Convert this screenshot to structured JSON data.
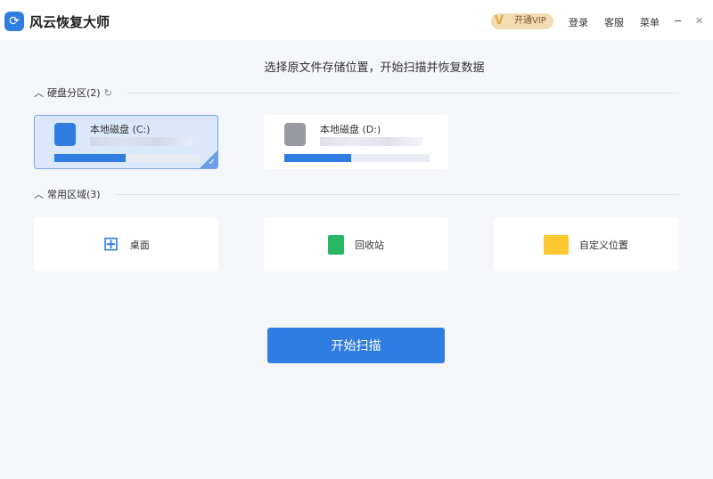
{
  "app": {
    "title": "风云恢复大师"
  },
  "titlebar": {
    "vip": "开通VIP",
    "login": "登录",
    "service": "客服",
    "menu": "菜单",
    "minimize": "−",
    "close": "✕"
  },
  "main": {
    "heading": "选择原文件存储位置，开始扫描并恢复数据",
    "partitions": {
      "label": "硬盘分区(2)",
      "drives": [
        {
          "name": "本地磁盘 (C:)",
          "used_percent": 49,
          "selected": true
        },
        {
          "name": "本地磁盘 (D:)",
          "used_percent": 46,
          "selected": false
        }
      ]
    },
    "common": {
      "label": "常用区域(3)",
      "items": [
        {
          "label": "桌面"
        },
        {
          "label": "回收站"
        },
        {
          "label": "自定义位置"
        }
      ]
    },
    "scan_button": "开始扫描"
  },
  "colors": {
    "accent": "#2f7de1"
  }
}
